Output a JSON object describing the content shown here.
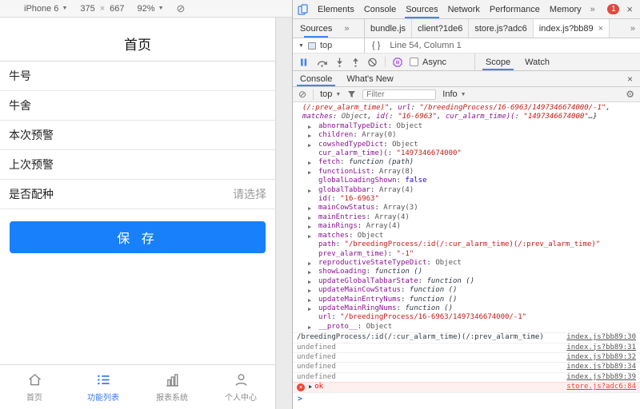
{
  "colors": {
    "accent_blue": "#1780fa",
    "tab_active_blue": "#3679f0",
    "devtools_accent": "#4285f4",
    "error_red": "#ff0000",
    "error_row_bg": "#fff0f0"
  },
  "icons": {
    "close": "×",
    "more": "»",
    "caret_down": "▼",
    "block": "⊘",
    "gear": "⚙",
    "arrow_right": "▶",
    "arrow_down": "▼"
  },
  "device_toolbar": {
    "device_label": "iPhone 6",
    "width": "375",
    "times": "×",
    "height": "667",
    "zoom": "92%"
  },
  "app": {
    "title": "首页",
    "form_rows": [
      {
        "label": "牛号",
        "value": ""
      },
      {
        "label": "牛舍",
        "value": ""
      },
      {
        "label": "本次预警",
        "value": ""
      },
      {
        "label": "上次预警",
        "value": ""
      },
      {
        "label": "是否配种",
        "value": "请选择"
      }
    ],
    "save_label": "保 存",
    "tabbar": [
      {
        "label": "首页",
        "icon": "home-icon",
        "active": false
      },
      {
        "label": "功能列表",
        "icon": "list-icon",
        "active": true
      },
      {
        "label": "报表系统",
        "icon": "chart-icon",
        "active": false
      },
      {
        "label": "个人中心",
        "icon": "user-icon",
        "active": false
      }
    ]
  },
  "devtools": {
    "main_tabs": [
      {
        "label": "Elements",
        "active": false
      },
      {
        "label": "Console",
        "active": false
      },
      {
        "label": "Sources",
        "active": true
      },
      {
        "label": "Network",
        "active": false
      },
      {
        "label": "Performance",
        "active": false
      },
      {
        "label": "Memory",
        "active": false
      }
    ],
    "error_badge": "1",
    "navigator_tab": "Sources",
    "file_tabs": [
      {
        "label": "bundle.js",
        "active": false
      },
      {
        "label": "client?1de6",
        "active": false
      },
      {
        "label": "store.js?adc6",
        "active": false
      },
      {
        "label": "index.js?bb89",
        "active": true
      }
    ],
    "file_tree_root": "top",
    "pretty_print": "{ }",
    "cursor_status": "Line 54, Column 1",
    "async_label": "Async",
    "scope_tab": "Scope",
    "watch_tab": "Watch",
    "drawer_tabs": [
      {
        "label": "Console",
        "active": true
      },
      {
        "label": "What's New",
        "active": false
      }
    ],
    "console": {
      "context": "top",
      "filter_placeholder": "Filter",
      "level": "Info",
      "prompt": ">",
      "preview_lines": [
        [
          {
            "c": "s",
            "t": "(/:prev_alarm_time)\""
          },
          {
            "c": "p",
            "t": ", "
          },
          {
            "c": "k",
            "t": "url"
          },
          {
            "c": "p",
            "t": ": "
          },
          {
            "c": "s",
            "t": "\"/breedingProcess/16-6963/1497346674000/-1\""
          },
          {
            "c": "p",
            "t": ","
          }
        ],
        [
          {
            "c": "k",
            "t": "matches"
          },
          {
            "c": "p",
            "t": ": "
          },
          {
            "c": "o",
            "t": "Object"
          },
          {
            "c": "p",
            "t": ", "
          },
          {
            "c": "k",
            "t": "id("
          },
          {
            "c": "p",
            "t": ": "
          },
          {
            "c": "s",
            "t": "\"16-6963\""
          },
          {
            "c": "p",
            "t": ", "
          },
          {
            "c": "k",
            "t": "cur_alarm_time)("
          },
          {
            "c": "p",
            "t": ": "
          },
          {
            "c": "s",
            "t": "\"1497346674000\""
          },
          {
            "c": "p",
            "t": "…}"
          }
        ]
      ],
      "properties": [
        {
          "arrow": true,
          "key": "abnormalTypeDict",
          "value": "Object",
          "type": "object"
        },
        {
          "arrow": true,
          "key": "children",
          "value": "Array(0)",
          "type": "object"
        },
        {
          "arrow": true,
          "key": "cowshedTypeDict",
          "value": "Object",
          "type": "object"
        },
        {
          "arrow": false,
          "key": "cur_alarm_time)(",
          "value": "\"1497346674000\"",
          "type": "string"
        },
        {
          "arrow": true,
          "key": "fetch",
          "value": "function (path)",
          "type": "function"
        },
        {
          "arrow": true,
          "key": "functionList",
          "value": "Array(8)",
          "type": "object"
        },
        {
          "arrow": false,
          "key": "globalLoadingShown",
          "value": "false",
          "type": "boolean"
        },
        {
          "arrow": true,
          "key": "globalTabbar",
          "value": "Array(4)",
          "type": "object"
        },
        {
          "arrow": false,
          "key": "id(",
          "value": "\"16-6963\"",
          "type": "string"
        },
        {
          "arrow": true,
          "key": "mainCowStatus",
          "value": "Array(3)",
          "type": "object"
        },
        {
          "arrow": true,
          "key": "mainEntries",
          "value": "Array(4)",
          "type": "object"
        },
        {
          "arrow": true,
          "key": "mainRings",
          "value": "Array(4)",
          "type": "object"
        },
        {
          "arrow": true,
          "key": "matches",
          "value": "Object",
          "type": "object"
        },
        {
          "arrow": false,
          "key": "path",
          "value": "\"/breedingProcess/:id(/:cur_alarm_time)(/:prev_alarm_time)\"",
          "type": "string"
        },
        {
          "arrow": false,
          "key": "prev_alarm_time)",
          "value": "\"-1\"",
          "type": "string"
        },
        {
          "arrow": true,
          "key": "reproductiveStateTypeDict",
          "value": "Object",
          "type": "object"
        },
        {
          "arrow": true,
          "key": "showLoading",
          "value": "function ()",
          "type": "function"
        },
        {
          "arrow": true,
          "key": "updateGlobalTabbarState",
          "value": "function ()",
          "type": "function"
        },
        {
          "arrow": true,
          "key": "updateMainCowStatus",
          "value": "function ()",
          "type": "function"
        },
        {
          "arrow": true,
          "key": "updateMainEntryNums",
          "value": "function ()",
          "type": "function"
        },
        {
          "arrow": true,
          "key": "updateMainRingNums",
          "value": "function ()",
          "type": "function"
        },
        {
          "arrow": false,
          "key": "url",
          "value": "\"/breedingProcess/16-6963/1497346674000/-1\"",
          "type": "string"
        },
        {
          "arrow": true,
          "key": "__proto__",
          "value": "Object",
          "type": "object"
        }
      ],
      "logs": [
        {
          "text": "/breedingProcess/:id(/:cur_alarm_time)(/:prev_alarm_time)",
          "link": "index.js?bb89:30",
          "level": "log",
          "arrow": false
        },
        {
          "text": "undefined",
          "link": "index.js?bb89:31",
          "level": "undef",
          "arrow": false
        },
        {
          "text": "undefined",
          "link": "index.js?bb89:32",
          "level": "undef",
          "arrow": false
        },
        {
          "text": "undefined",
          "link": "index.js?bb89:34",
          "level": "undef",
          "arrow": false
        },
        {
          "text": "undefined",
          "link": "index.js?bb89:39",
          "level": "undef",
          "arrow": false
        },
        {
          "text": "ok",
          "link": "store.js?adc6:84",
          "level": "error",
          "arrow": true
        }
      ]
    }
  }
}
